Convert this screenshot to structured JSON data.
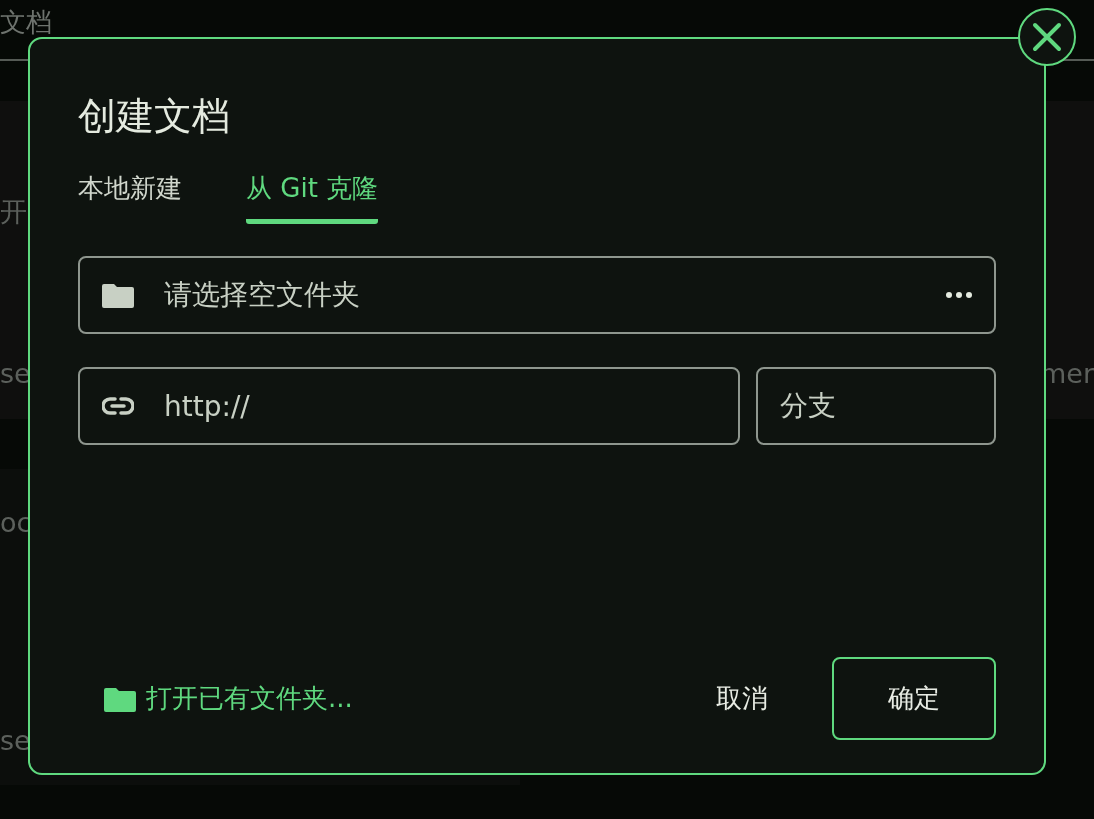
{
  "background": {
    "title": "文档",
    "upper_panel": {
      "left_texts": [
        "开",
        "se"
      ],
      "right_text": "mer"
    },
    "lower_panel": {
      "texts": [
        "oc",
        "se"
      ]
    }
  },
  "dialog": {
    "title": "创建文档",
    "tabs": [
      {
        "label": "本地新建",
        "selected": false
      },
      {
        "label": "从 Git 克隆",
        "selected": true
      }
    ],
    "folder_field": {
      "placeholder": "请选择空文件夹"
    },
    "url_field": {
      "placeholder": "http://"
    },
    "branch_field": {
      "placeholder": "分支"
    },
    "open_folder_link": "打开已有文件夹...",
    "buttons": [
      {
        "label": "取消",
        "kind": "text"
      },
      {
        "label": "确定",
        "kind": "outlined"
      }
    ]
  }
}
